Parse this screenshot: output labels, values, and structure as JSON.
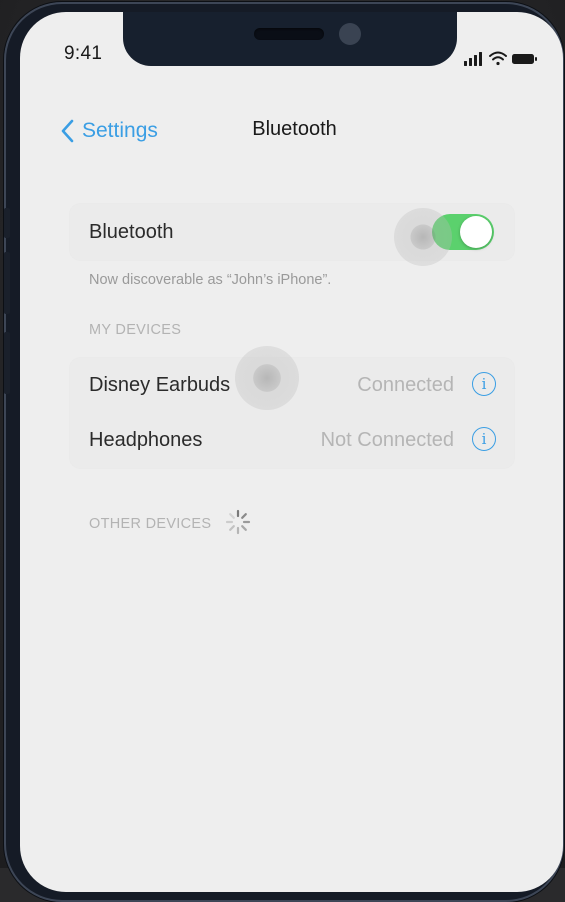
{
  "status_bar": {
    "time": "9:41",
    "icons": [
      "cellular-signal-icon",
      "wifi-icon",
      "battery-icon"
    ]
  },
  "nav": {
    "back_label": "Settings",
    "back_icon": "chevron-left-icon",
    "title": "Bluetooth"
  },
  "bluetooth": {
    "label": "Bluetooth",
    "enabled": true,
    "discoverable_note": "Now discoverable as “John’s iPhone”."
  },
  "my_devices": {
    "header": "MY DEVICES",
    "items": [
      {
        "name": "Disney Earbuds",
        "status": "Connected",
        "icon": "info-icon"
      },
      {
        "name": "Headphones",
        "status": "Not Connected",
        "icon": "info-icon"
      }
    ]
  },
  "other_devices": {
    "header": "OTHER DEVICES",
    "icon": "loading-spinner-icon"
  },
  "colors": {
    "accent": "#3a9ee4",
    "toggle_on": "#5bd16d",
    "background": "#eeeeee"
  }
}
